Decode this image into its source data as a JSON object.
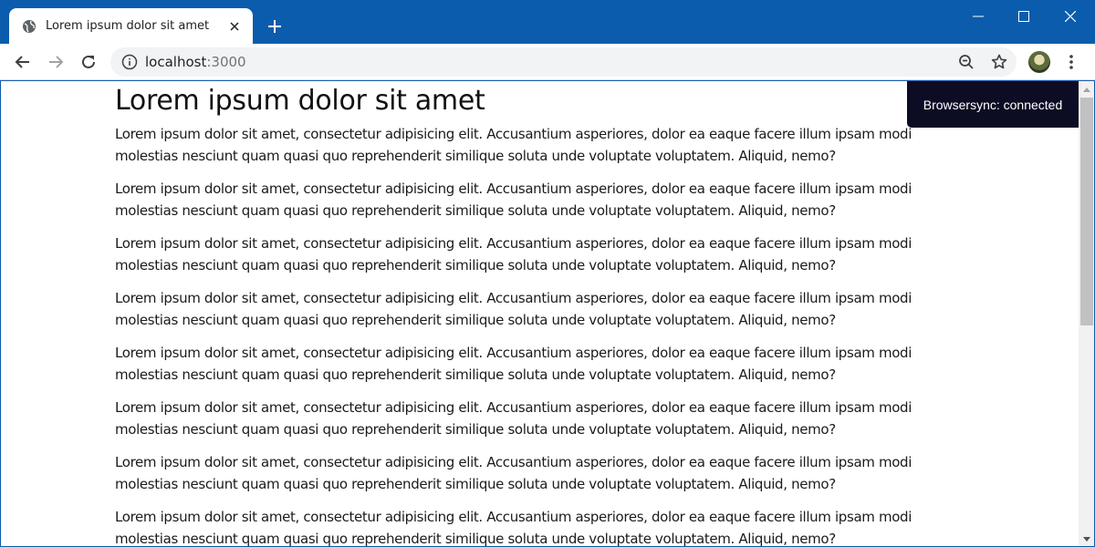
{
  "colors": {
    "titlebar": "#0b5cad",
    "notify_bg": "#0c0c24"
  },
  "tab": {
    "title": "Lorem ipsum dolor sit amet",
    "favicon": "globe-icon",
    "close_icon": "close-icon"
  },
  "window": {
    "minimize_icon": "minimize-icon",
    "maximize_icon": "maximize-icon",
    "close_icon": "close-icon"
  },
  "toolbar": {
    "url_host": "localhost",
    "url_port": ":3000",
    "icons": [
      "back-icon",
      "forward-icon",
      "reload-icon",
      "info-icon",
      "zoom-icon",
      "star-icon",
      "menu-icon"
    ]
  },
  "page": {
    "heading": "Lorem ipsum dolor sit amet",
    "paragraphs": [
      "Lorem ipsum dolor sit amet, consectetur adipisicing elit. Accusantium asperiores, dolor ea eaque facere illum ipsam modi molestias nesciunt quam quasi quo reprehenderit similique soluta unde voluptate voluptatem. Aliquid, nemo?",
      "Lorem ipsum dolor sit amet, consectetur adipisicing elit. Accusantium asperiores, dolor ea eaque facere illum ipsam modi molestias nesciunt quam quasi quo reprehenderit similique soluta unde voluptate voluptatem. Aliquid, nemo?",
      "Lorem ipsum dolor sit amet, consectetur adipisicing elit. Accusantium asperiores, dolor ea eaque facere illum ipsam modi molestias nesciunt quam quasi quo reprehenderit similique soluta unde voluptate voluptatem. Aliquid, nemo?",
      "Lorem ipsum dolor sit amet, consectetur adipisicing elit. Accusantium asperiores, dolor ea eaque facere illum ipsam modi molestias nesciunt quam quasi quo reprehenderit similique soluta unde voluptate voluptatem. Aliquid, nemo?",
      "Lorem ipsum dolor sit amet, consectetur adipisicing elit. Accusantium asperiores, dolor ea eaque facere illum ipsam modi molestias nesciunt quam quasi quo reprehenderit similique soluta unde voluptate voluptatem. Aliquid, nemo?",
      "Lorem ipsum dolor sit amet, consectetur adipisicing elit. Accusantium asperiores, dolor ea eaque facere illum ipsam modi molestias nesciunt quam quasi quo reprehenderit similique soluta unde voluptate voluptatem. Aliquid, nemo?",
      "Lorem ipsum dolor sit amet, consectetur adipisicing elit. Accusantium asperiores, dolor ea eaque facere illum ipsam modi molestias nesciunt quam quasi quo reprehenderit similique soluta unde voluptate voluptatem. Aliquid, nemo?",
      "Lorem ipsum dolor sit amet, consectetur adipisicing elit. Accusantium asperiores, dolor ea eaque facere illum ipsam modi molestias nesciunt quam quasi quo reprehenderit similique soluta unde voluptate voluptatem. Aliquid, nemo?"
    ]
  },
  "notification": {
    "text": "Browsersync: connected"
  }
}
